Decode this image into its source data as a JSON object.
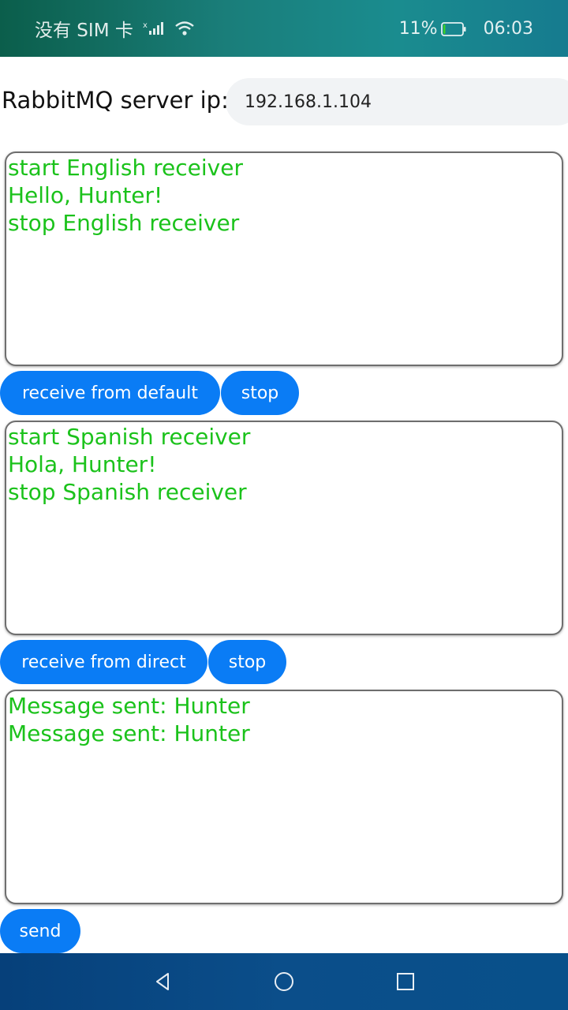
{
  "status_bar": {
    "carrier": "没有 SIM 卡",
    "battery_percent": "11%",
    "battery_level": 0.11,
    "time": "06:03",
    "icons": [
      "signal-icon",
      "wifi-icon",
      "battery-icon"
    ]
  },
  "server": {
    "label": "RabbitMQ server ip:",
    "ip": "192.168.1.104"
  },
  "english_log": [
    "start English receiver",
    "Hello, Hunter!",
    "stop English receiver"
  ],
  "spanish_log": [
    "start Spanish receiver",
    "Hola, Hunter!",
    "stop Spanish receiver"
  ],
  "sent_log": [
    "Message sent: Hunter",
    "Message sent: Hunter"
  ],
  "buttons": {
    "receive_default": "receive from default",
    "stop_default": "stop",
    "receive_direct": "receive from direct",
    "stop_direct": "stop",
    "send": "send"
  },
  "colors": {
    "accent": "#0a7cf5",
    "log_text": "#1bc21b"
  },
  "nav_bar": {
    "icons": [
      "back-icon",
      "home-icon",
      "recents-icon"
    ]
  }
}
